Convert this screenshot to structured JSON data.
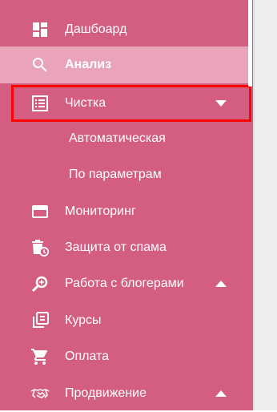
{
  "sidebar": {
    "items": [
      {
        "label": "Дашбоард",
        "icon": "dashboard-icon"
      },
      {
        "label": "Анализ",
        "icon": "search-icon"
      },
      {
        "label": "Чистка",
        "icon": "list-icon"
      },
      {
        "label": "Мониторинг",
        "icon": "card-icon"
      },
      {
        "label": "Защита от спама",
        "icon": "trash-clock-icon"
      },
      {
        "label": "Работа с блогерами",
        "icon": "zoom-search-icon"
      },
      {
        "label": "Курсы",
        "icon": "library-icon"
      },
      {
        "label": "Оплата",
        "icon": "cart-icon"
      },
      {
        "label": "Продвижение",
        "icon": "handshake-icon"
      }
    ],
    "cleaning_submenu": [
      {
        "label": "Автоматическая"
      },
      {
        "label": "По параметрам"
      }
    ]
  },
  "colors": {
    "sidebar_bg": "#d45d82",
    "active_bg": "#e9a4ba",
    "text": "#ffffff",
    "highlight": "#ff0000"
  }
}
